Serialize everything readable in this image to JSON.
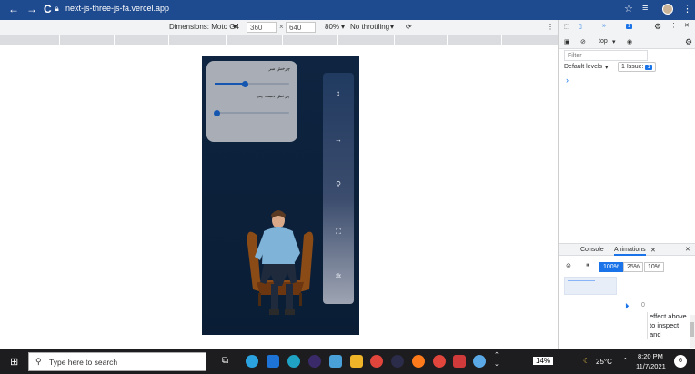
{
  "browser": {
    "url": "next-js-three-js-fa.vercel.app",
    "back_label": "←",
    "forward_label": "→",
    "reload_label": "C"
  },
  "device_toolbar": {
    "dimensions_label": "Dimensions: Moto G4",
    "width_value": "360",
    "times_symbol": "×",
    "height_value": "640",
    "zoom_label": "80%",
    "throttle_label": "No throttling"
  },
  "app": {
    "slider1_label": "چرخش سر",
    "slider1_value": 0.4,
    "slider2_label": "چرخش دست چپ",
    "slider2_value": 0.0,
    "side_icons": [
      "vertical-arrows",
      "horizontal-arrows",
      "search",
      "fullscreen",
      "settings"
    ]
  },
  "devtools": {
    "top_context": "top",
    "issues_badge": "1",
    "filter_placeholder": "Filter",
    "levels_label": "Default levels",
    "issue_label": "1 Issue:",
    "issue_count": "1",
    "console_prompt": "›",
    "tabs": [
      "Console",
      "Animations"
    ],
    "speeds": [
      "100%",
      "25%",
      "10%"
    ],
    "active_speed": "100%",
    "timeline_zero": "0",
    "anim_help_text": "effect above to inspect and"
  },
  "taskbar": {
    "search_placeholder": "Type here to search",
    "cpu_label": "14%",
    "temperature": "25°C",
    "time": "8:20 PM",
    "date": "11/7/2021",
    "notifications": "6"
  },
  "colors": {
    "chrome_bar": "#1e4a8f",
    "slider_accent": "#1557b0",
    "scene_bg": "#0a1d35",
    "devtools_blue": "#1a73e8"
  }
}
